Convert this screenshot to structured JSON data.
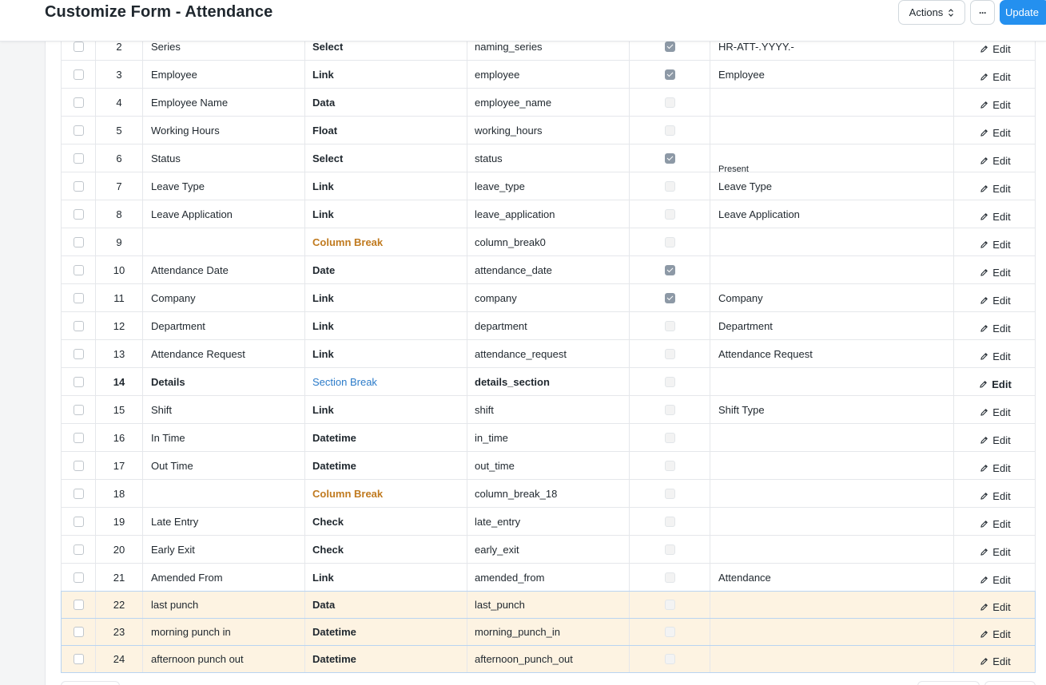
{
  "header": {
    "title": "Customize Form - Attendance",
    "actions_label": "Actions",
    "more_label": "···",
    "update_label": "Update"
  },
  "icons": {
    "actions_caret": "chevron-up-down-icon",
    "edit": "pencil-icon"
  },
  "colors": {
    "primary": "#2490ef",
    "column_break": "#c07a1f",
    "section_break": "#2b7bc9",
    "highlight_row": "#fdf3e2"
  },
  "fields": [
    {
      "idx": "2",
      "label": "Series",
      "type": "Select",
      "fieldname": "naming_series",
      "reqd": true,
      "options": "HR-ATT-.YYYY.-",
      "edit": "Edit"
    },
    {
      "idx": "3",
      "label": "Employee",
      "type": "Link",
      "fieldname": "employee",
      "reqd": true,
      "options": "Employee",
      "edit": "Edit"
    },
    {
      "idx": "4",
      "label": "Employee Name",
      "type": "Data",
      "fieldname": "employee_name",
      "reqd": false,
      "options": "",
      "edit": "Edit"
    },
    {
      "idx": "5",
      "label": "Working Hours",
      "type": "Float",
      "fieldname": "working_hours",
      "reqd": false,
      "options": "",
      "edit": "Edit"
    },
    {
      "idx": "6",
      "label": "Status",
      "type": "Select",
      "fieldname": "status",
      "reqd": true,
      "options": "Present",
      "clipped": true,
      "edit": "Edit"
    },
    {
      "idx": "7",
      "label": "Leave Type",
      "type": "Link",
      "fieldname": "leave_type",
      "reqd": false,
      "options": "Leave Type",
      "edit": "Edit"
    },
    {
      "idx": "8",
      "label": "Leave Application",
      "type": "Link",
      "fieldname": "leave_application",
      "reqd": false,
      "options": "Leave Application",
      "edit": "Edit"
    },
    {
      "idx": "9",
      "label": "",
      "type": "Column Break",
      "fieldname": "column_break0",
      "reqd": false,
      "options": "",
      "edit": "Edit"
    },
    {
      "idx": "10",
      "label": "Attendance Date",
      "type": "Date",
      "fieldname": "attendance_date",
      "reqd": true,
      "options": "",
      "edit": "Edit"
    },
    {
      "idx": "11",
      "label": "Company",
      "type": "Link",
      "fieldname": "company",
      "reqd": true,
      "options": "Company",
      "edit": "Edit"
    },
    {
      "idx": "12",
      "label": "Department",
      "type": "Link",
      "fieldname": "department",
      "reqd": false,
      "options": "Department",
      "edit": "Edit"
    },
    {
      "idx": "13",
      "label": "Attendance Request",
      "type": "Link",
      "fieldname": "attendance_request",
      "reqd": false,
      "options": "Attendance Request",
      "edit": "Edit"
    },
    {
      "idx": "14",
      "label": "Details",
      "type": "Section Break",
      "fieldname": "details_section",
      "reqd": false,
      "options": "",
      "bold": true,
      "edit": "Edit"
    },
    {
      "idx": "15",
      "label": "Shift",
      "type": "Link",
      "fieldname": "shift",
      "reqd": false,
      "options": "Shift Type",
      "edit": "Edit"
    },
    {
      "idx": "16",
      "label": "In Time",
      "type": "Datetime",
      "fieldname": "in_time",
      "reqd": false,
      "options": "",
      "edit": "Edit"
    },
    {
      "idx": "17",
      "label": "Out Time",
      "type": "Datetime",
      "fieldname": "out_time",
      "reqd": false,
      "options": "",
      "edit": "Edit"
    },
    {
      "idx": "18",
      "label": "",
      "type": "Column Break",
      "fieldname": "column_break_18",
      "reqd": false,
      "options": "",
      "edit": "Edit"
    },
    {
      "idx": "19",
      "label": "Late Entry",
      "type": "Check",
      "fieldname": "late_entry",
      "reqd": false,
      "options": "",
      "edit": "Edit"
    },
    {
      "idx": "20",
      "label": "Early Exit",
      "type": "Check",
      "fieldname": "early_exit",
      "reqd": false,
      "options": "",
      "edit": "Edit"
    },
    {
      "idx": "21",
      "label": "Amended From",
      "type": "Link",
      "fieldname": "amended_from",
      "reqd": false,
      "options": "Attendance",
      "edit": "Edit"
    },
    {
      "idx": "22",
      "label": "last punch",
      "type": "Data",
      "fieldname": "last_punch",
      "reqd": false,
      "options": "",
      "custom": true,
      "edit": "Edit"
    },
    {
      "idx": "23",
      "label": "morning punch in",
      "type": "Datetime",
      "fieldname": "morning_punch_in",
      "reqd": false,
      "options": "",
      "custom": true,
      "edit": "Edit"
    },
    {
      "idx": "24",
      "label": "afternoon punch out",
      "type": "Datetime",
      "fieldname": "afternoon_punch_out",
      "reqd": false,
      "options": "",
      "custom": true,
      "edit": "Edit"
    }
  ]
}
